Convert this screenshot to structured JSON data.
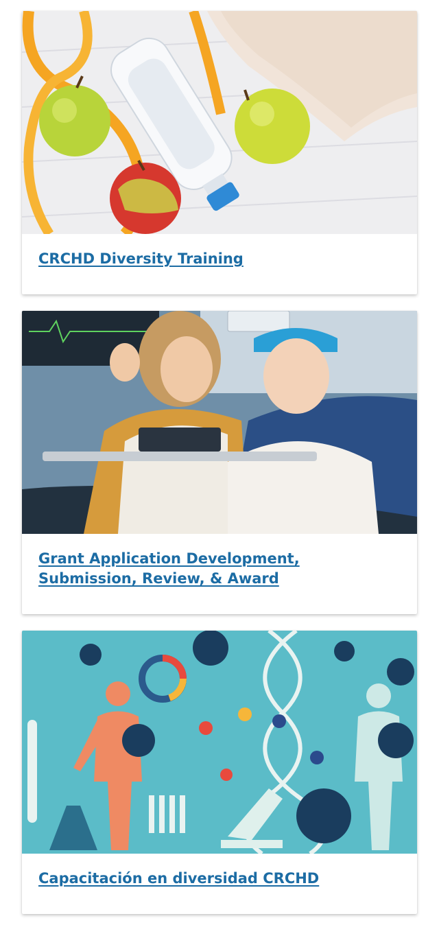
{
  "cards": [
    {
      "title": "CRCHD Diversity Training",
      "image": "healthy-lifestyle-photo"
    },
    {
      "title": "Grant Application Development, Submission, Review, & Award",
      "image": "patient-video-call-photo"
    },
    {
      "title": "Capacitación en diversidad CRCHD",
      "image": "science-illustration"
    }
  ],
  "colors": {
    "link": "#1c6ca4",
    "illustration_bg": "#5bbcc8"
  }
}
